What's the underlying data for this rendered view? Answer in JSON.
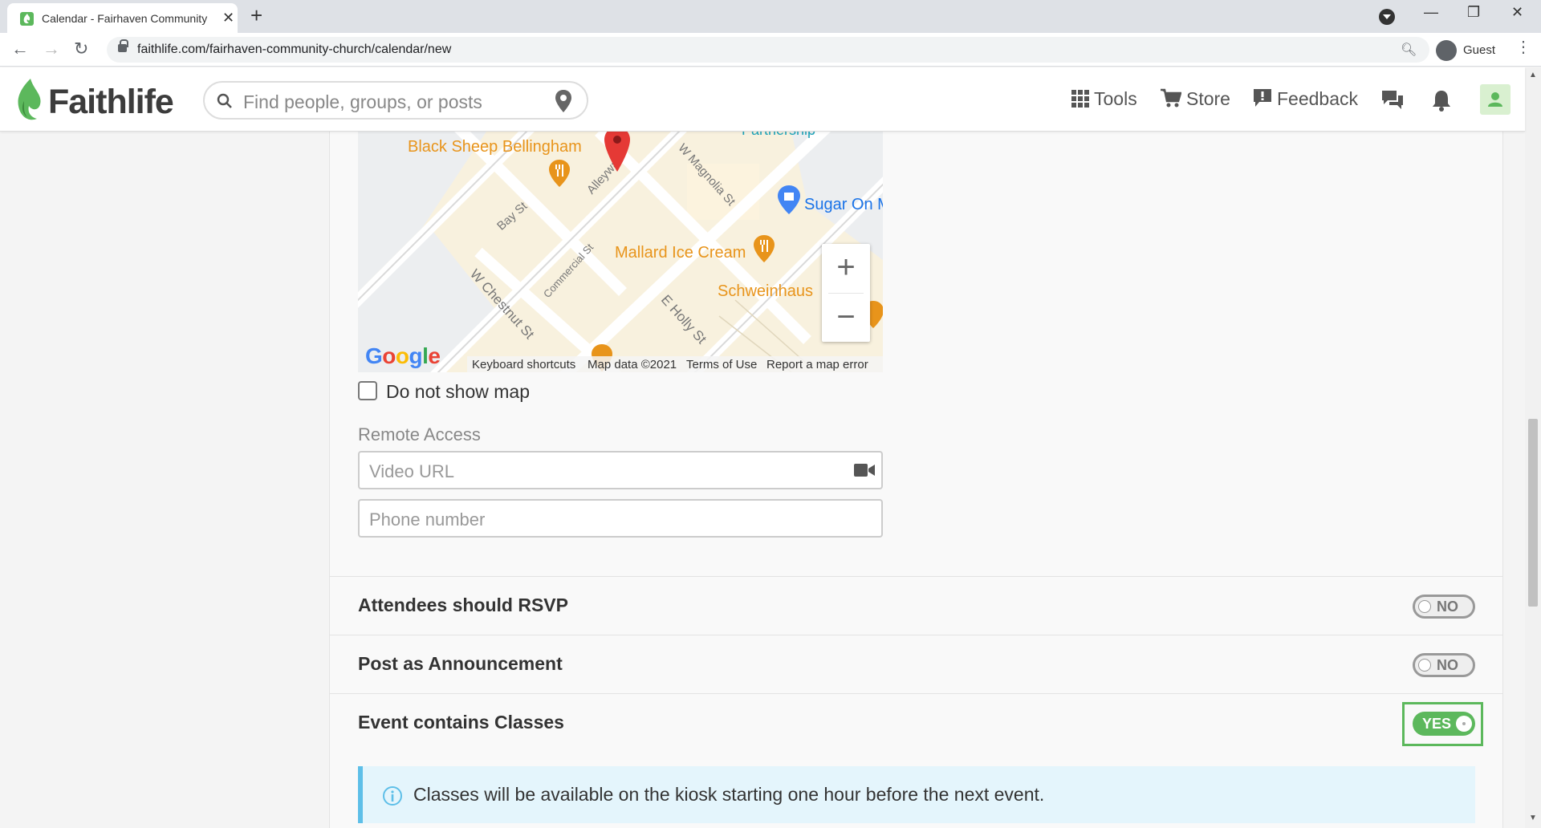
{
  "browser": {
    "tab_title": "Calendar - Fairhaven Community",
    "url": "faithlife.com/fairhaven-community-church/calendar/new",
    "profile_label": "Guest"
  },
  "header": {
    "logo_text": "Faithlife",
    "search_placeholder": "Find people, groups, or posts",
    "nav": {
      "tools": "Tools",
      "store": "Store",
      "feedback": "Feedback"
    }
  },
  "map": {
    "places": {
      "black_sheep": "Black Sheep Bellingham",
      "sugar_on": "Sugar On M",
      "mallard": "Mallard Ice Cream",
      "schweinhaus": "Schweinhaus",
      "partnership": "Partnership"
    },
    "streets": {
      "bay": "Bay St",
      "alleyway": "Alleywa",
      "w_magnolia": "W Magnolia St",
      "commercial": "Commercial St",
      "w_chestnut": "W Chestnut St",
      "e_holly": "E Holly St"
    },
    "zoom_in": "+",
    "zoom_out": "−",
    "google": "Google",
    "footer": {
      "shortcuts": "Keyboard shortcuts",
      "map_data": "Map data ©2021",
      "terms": "Terms of Use",
      "report": "Report a map error"
    }
  },
  "form": {
    "do_not_show_map": "Do not show map",
    "remote_access_label": "Remote Access",
    "video_url_placeholder": "Video URL",
    "phone_placeholder": "Phone number",
    "rows": {
      "rsvp": {
        "label": "Attendees should RSVP",
        "toggle": "NO"
      },
      "announcement": {
        "label": "Post as Announcement",
        "toggle": "NO"
      },
      "classes": {
        "label": "Event contains Classes",
        "toggle": "YES"
      }
    },
    "info_text": "Classes will be available on the kiosk starting one hour before the next event."
  },
  "colors": {
    "brand_green": "#5cb85c",
    "info_blue": "#5ebfe8",
    "map_orange": "#e8941b"
  }
}
